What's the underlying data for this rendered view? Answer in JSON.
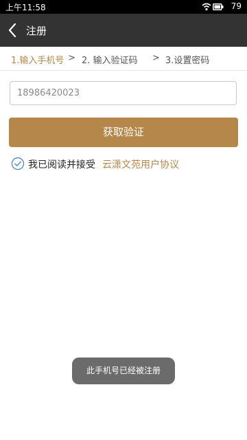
{
  "status_bar": {
    "time": "上午11:58",
    "battery_level": "79",
    "icons": [
      "wifi-icon",
      "battery-icon"
    ]
  },
  "app_bar": {
    "title": "注册",
    "back_icon": "back-chevron-icon"
  },
  "steps": {
    "items": [
      "1.输入手机号",
      "2. 输入验证码",
      "3.设置密码"
    ],
    "separator": ">",
    "active_index": 0
  },
  "form": {
    "phone_value": "18986420023",
    "get_code_label": "获取验证"
  },
  "agreement": {
    "checked": true,
    "text": "我已阅读并接受",
    "link_text": "云潇文苑用户协议"
  },
  "toast": {
    "message": "此手机号已经被注册"
  },
  "colors": {
    "accent": "#b5874a",
    "app_bar": "#333333",
    "status_bar": "#000000",
    "toast_bg": "#6b6b6b",
    "checkbox": "#5a8fc8"
  }
}
